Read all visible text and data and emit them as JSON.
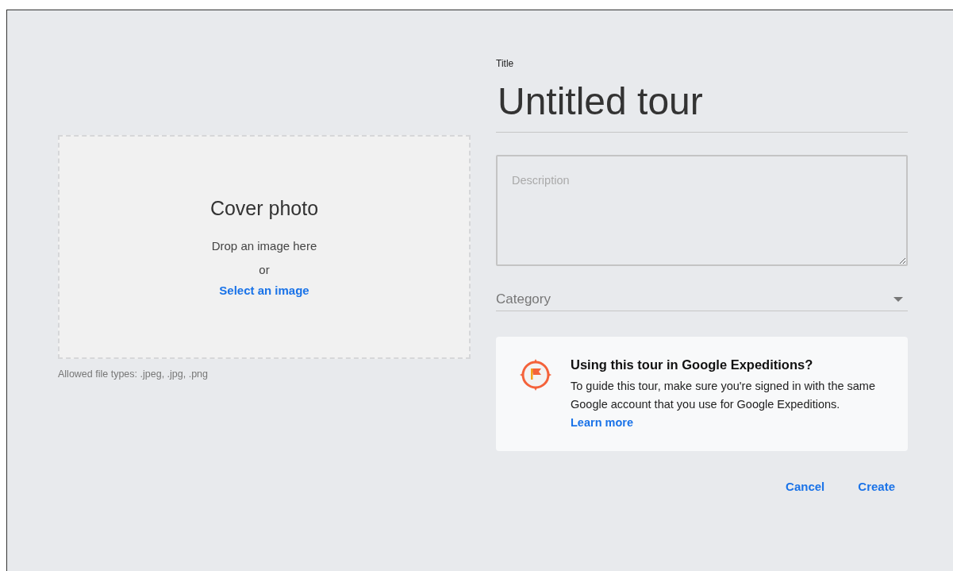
{
  "cover_photo": {
    "heading": "Cover photo",
    "hint": "Drop an image here",
    "separator": "or",
    "select_link": "Select an image",
    "allowed_types": "Allowed file types: .jpeg, .jpg, .png"
  },
  "title_field": {
    "label": "Title",
    "value": "Untitled tour"
  },
  "description_field": {
    "placeholder": "Description"
  },
  "category_dropdown": {
    "label": "Category"
  },
  "info_card": {
    "heading": "Using this tour in Google Expeditions?",
    "body": "To guide this tour, make sure you're signed in with the same Google account that you use for Google Expeditions.",
    "link": "Learn more"
  },
  "buttons": [
    {
      "label": "Cancel"
    },
    {
      "label": "Create"
    }
  ]
}
